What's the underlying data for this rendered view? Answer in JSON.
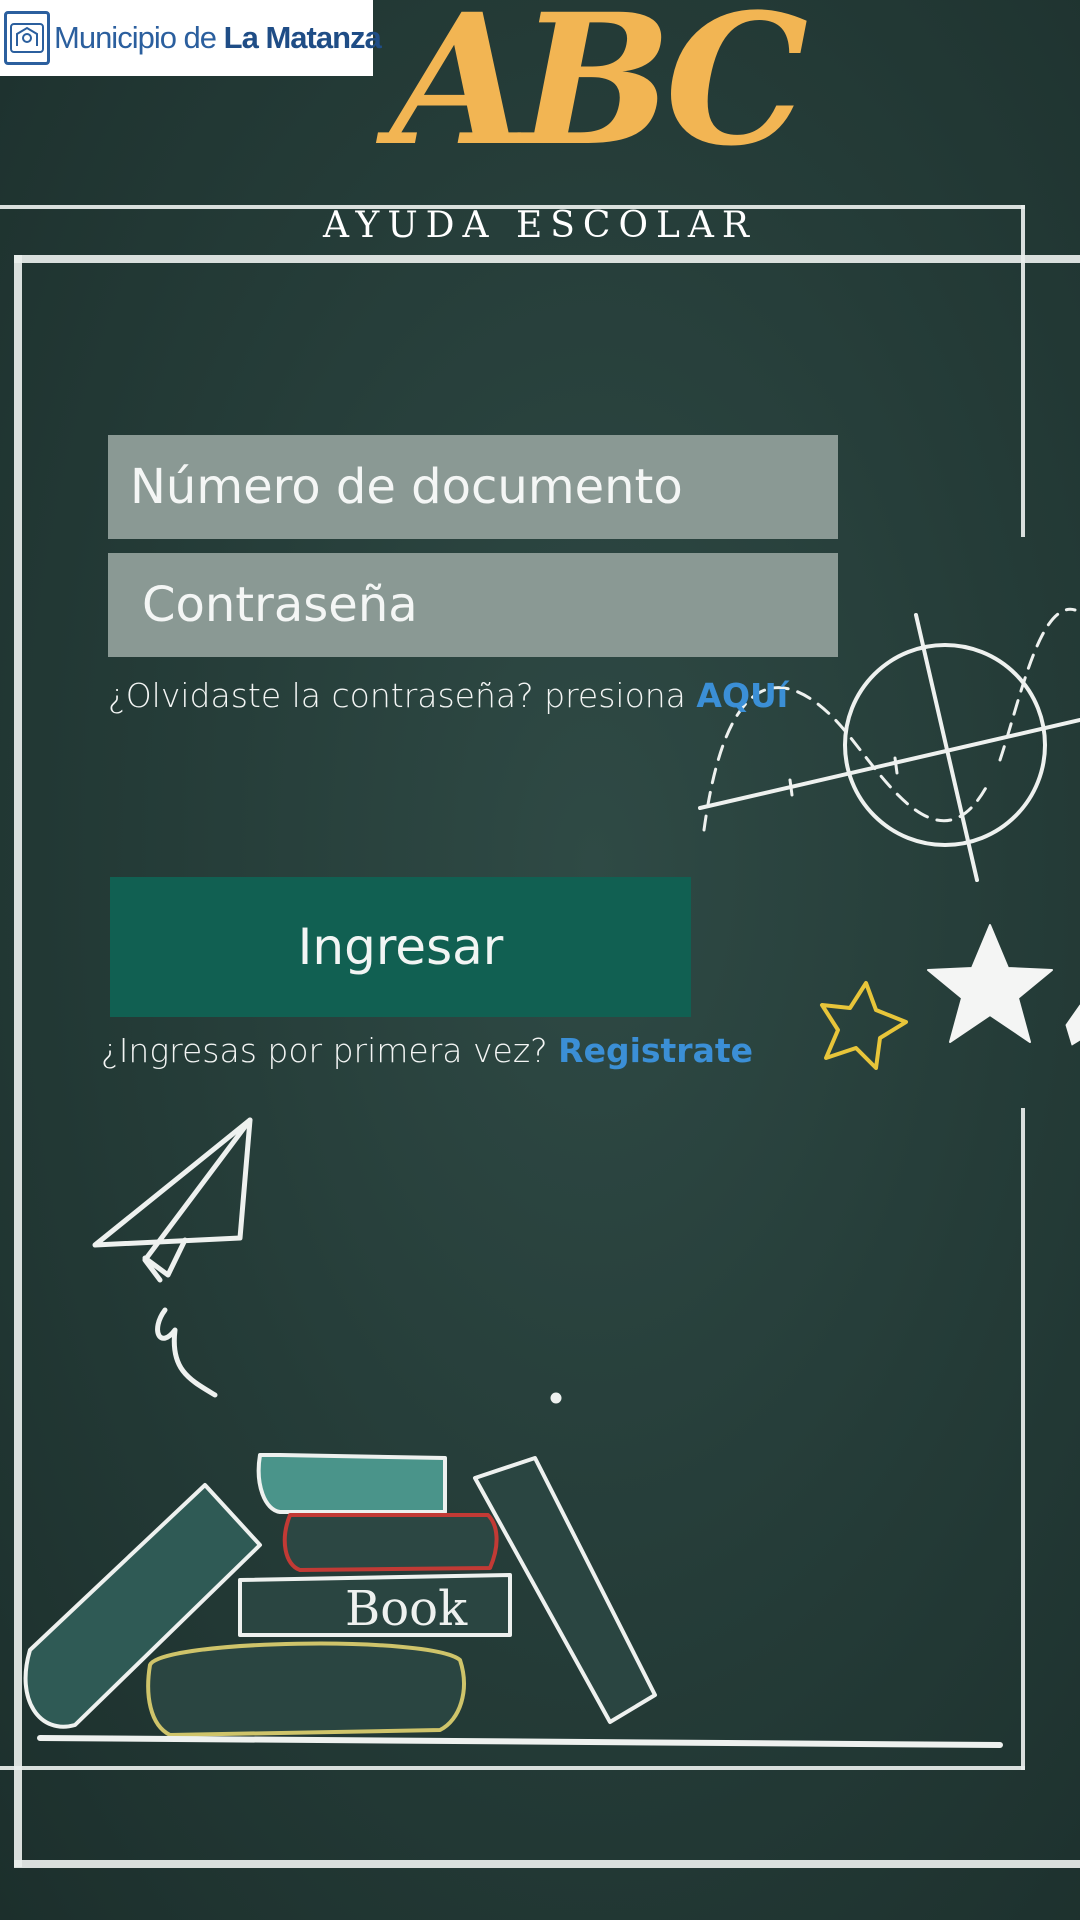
{
  "logo": {
    "prefix": "Municipio de ",
    "bold": "La Matanza",
    "crest_icon": "municipal-crest-icon"
  },
  "app": {
    "title": "ABC",
    "subtitle": "AYUDA ESCOLAR"
  },
  "form": {
    "document_placeholder": "Número de documento",
    "password_placeholder": "Contraseña",
    "forgot_text": "¿Olvidaste la contraseña? presiona ",
    "forgot_link": "AQUí",
    "submit_label": "Ingresar",
    "register_text": "¿Ingresas por primera vez? ",
    "register_link": "Registrate"
  },
  "colors": {
    "background": "#243b37",
    "title_accent": "#f2b553",
    "input_bg": "#8a9994",
    "button_bg": "#116052",
    "link": "#3b8fd6"
  },
  "decorations": [
    "chalk-frame",
    "math-graph-doodle",
    "stars-doodle",
    "paper-plane-doodle",
    "books-doodle"
  ]
}
